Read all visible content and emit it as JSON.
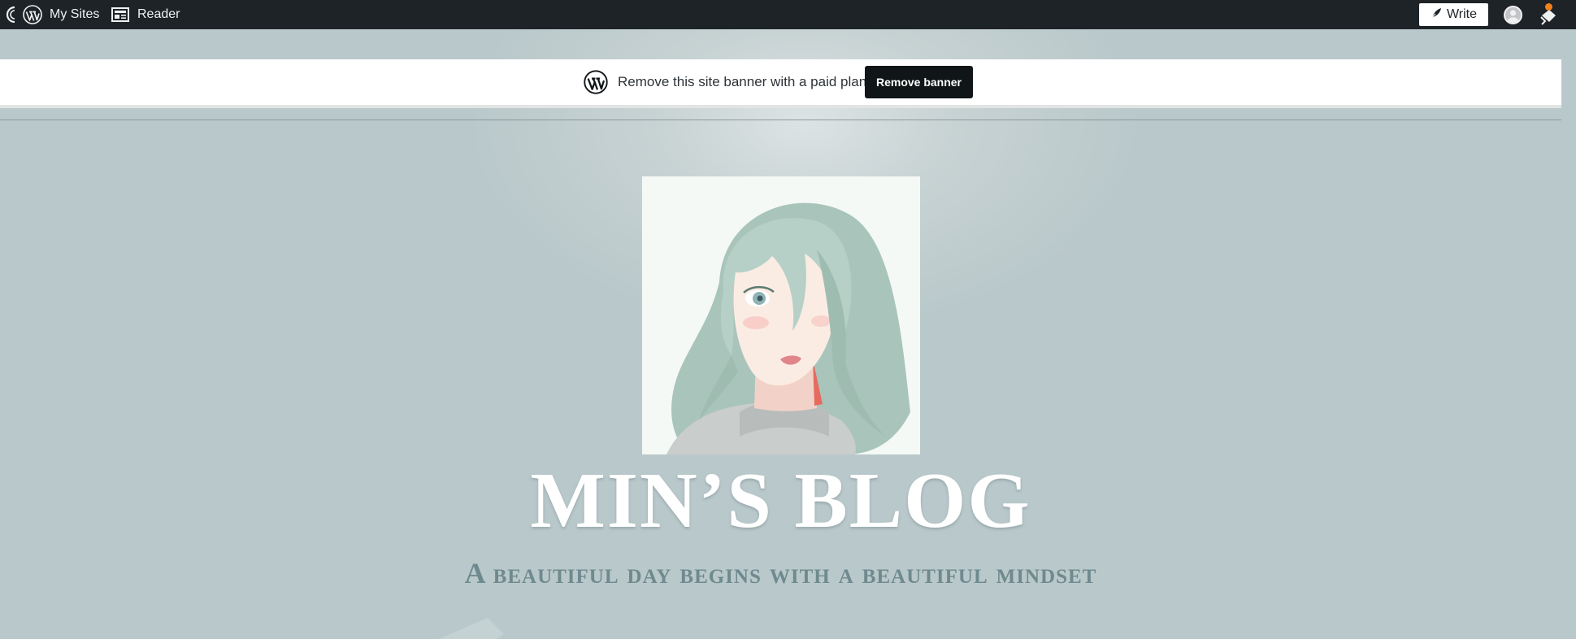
{
  "admin_bar": {
    "my_sites_label": "My Sites",
    "reader_label": "Reader",
    "write_label": "Write",
    "icons": [
      "collapse-icon",
      "wordpress-logo-icon",
      "reader-icon",
      "write-pen-icon",
      "avatar",
      "notifications-bell-icon"
    ],
    "notification_dot_color": "#f0821e"
  },
  "banner": {
    "text": "Remove this site banner with a paid plan",
    "button_label": "Remove banner"
  },
  "site": {
    "title": "MIN’S BLOG",
    "tagline": "A beautiful day begins with a beautiful mindset"
  },
  "colors": {
    "admin_bar_bg": "#1d2327",
    "page_bg": "#b9c8ca",
    "tagline": "#6f8a8f",
    "title": "#ffffff",
    "button_bg": "#101517"
  }
}
